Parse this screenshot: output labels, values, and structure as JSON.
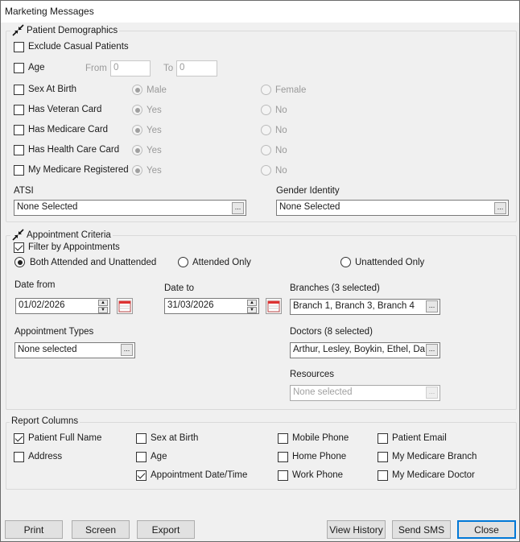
{
  "window": {
    "title": "Marketing Messages"
  },
  "demographics": {
    "legend": "Patient Demographics",
    "exclude_casual": {
      "label": "Exclude Casual Patients",
      "checked": false
    },
    "age": {
      "label": "Age",
      "from_label": "From",
      "from_value": "0",
      "to_label": "To",
      "to_value": "0",
      "checked": false
    },
    "sex": {
      "label": "Sex At Birth",
      "opt1": "Male",
      "opt2": "Female",
      "checked": false
    },
    "veteran": {
      "label": "Has Veteran Card",
      "opt1": "Yes",
      "opt2": "No",
      "checked": false
    },
    "medicare": {
      "label": "Has Medicare Card",
      "opt1": "Yes",
      "opt2": "No",
      "checked": false
    },
    "health_care": {
      "label": "Has Health Care Card",
      "opt1": "Yes",
      "opt2": "No",
      "checked": false
    },
    "my_medicare": {
      "label": "My Medicare Registered",
      "opt1": "Yes",
      "opt2": "No",
      "checked": false
    },
    "atsi": {
      "label": "ATSI",
      "value": "None Selected"
    },
    "gender_identity": {
      "label": "Gender Identity",
      "value": "None Selected"
    },
    "ellipsis": "..."
  },
  "appointments": {
    "legend": "Appointment Criteria",
    "filter": {
      "label": "Filter by Appointments",
      "checked": true
    },
    "radio_both": "Both Attended and Unattended",
    "radio_attended": "Attended Only",
    "radio_unattended": "Unattended Only",
    "date_from": {
      "label": "Date from",
      "value": "01/02/2026"
    },
    "date_to": {
      "label": "Date to",
      "value": "31/03/2026"
    },
    "branches": {
      "label": "Branches (3 selected)",
      "value": "Branch 1, Branch 3, Branch 4"
    },
    "types": {
      "label": "Appointment Types",
      "value": "None selected"
    },
    "doctors": {
      "label": "Doctors (8 selected)",
      "value": "Arthur, Lesley, Boykin, Ethel, Da"
    },
    "resources": {
      "label": "Resources",
      "value": "None selected"
    }
  },
  "report_columns": {
    "legend": "Report Columns",
    "items": [
      {
        "label": "Patient Full Name",
        "checked": true
      },
      {
        "label": "Address",
        "checked": false
      },
      {
        "label": "Sex at Birth",
        "checked": false
      },
      {
        "label": "Age",
        "checked": false
      },
      {
        "label": "Appointment Date/Time",
        "checked": true
      },
      {
        "label": "Mobile Phone",
        "checked": false
      },
      {
        "label": "Home Phone",
        "checked": false
      },
      {
        "label": "Work Phone",
        "checked": false
      },
      {
        "label": "Patient Email",
        "checked": false
      },
      {
        "label": "My Medicare Branch",
        "checked": false
      },
      {
        "label": "My Medicare Doctor",
        "checked": false
      }
    ]
  },
  "buttons": {
    "print": "Print",
    "screen": "Screen",
    "export": "Export",
    "view_history": "View History",
    "send_sms": "Send SMS",
    "close": "Close"
  }
}
